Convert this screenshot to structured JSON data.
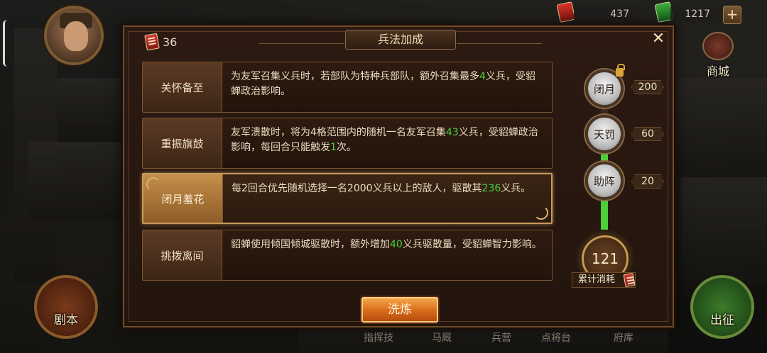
{
  "hud": {
    "resource_1": "437",
    "resource_2": "1217",
    "plus": "+",
    "city_label": "商城",
    "left_round_label": "剧本",
    "right_round_label": "出征",
    "bottom_tabs": [
      "指挥技",
      "马厩",
      "兵营",
      "点将台",
      "府库"
    ]
  },
  "panel": {
    "title": "兵法加成",
    "close": "✕",
    "currency_value": "36",
    "skills": [
      {
        "name": "关怀备至",
        "desc_parts": [
          "为友军召集义兵时，若部队为特种兵部队，额外召集最多",
          "4",
          "义兵，受貂蝉政治影响。"
        ],
        "active": false
      },
      {
        "name": "重振旗鼓",
        "desc_parts": [
          "友军溃散时，将为4格范围内的随机一名友军召集",
          "43",
          "义兵，受貂蝉政治影响，每回合只能触发",
          "1",
          "次。"
        ],
        "active": false
      },
      {
        "name": "闭月羞花",
        "desc_parts": [
          "每2回合优先随机选择一名2000义兵以上的敌人，驱散其",
          "236",
          "义兵。"
        ],
        "active": true
      },
      {
        "name": "挑拨离间",
        "desc_parts": [
          "貂蝉使用倾国倾城驱散时，额外增加",
          "40",
          "义兵驱散量，受貂蝉智力影响。"
        ],
        "active": false
      }
    ],
    "tiers": [
      {
        "name": "闭月",
        "cost": "200",
        "locked": true
      },
      {
        "name": "天罚",
        "cost": "60",
        "locked": false
      },
      {
        "name": "助阵",
        "cost": "20",
        "locked": false
      }
    ],
    "total_value": "121",
    "total_label": "累计消耗",
    "wash_button": "洗炼"
  },
  "colors": {
    "highlight_green": "#47d23b",
    "accent_orange": "#d86a1a",
    "frame_gold": "#c29a52"
  }
}
